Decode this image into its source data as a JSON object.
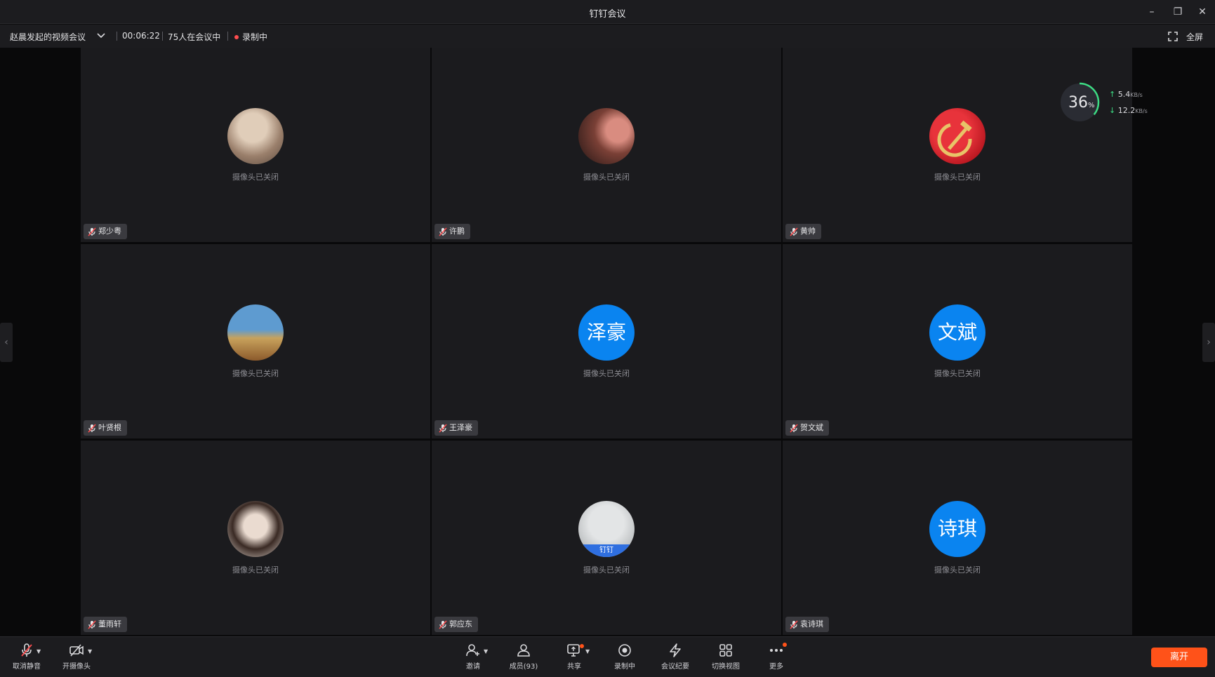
{
  "window": {
    "title": "钉钉会议",
    "minimize": "–",
    "maximize": "❐",
    "close": "✕"
  },
  "infobar": {
    "meeting_name": "赵晨发起的视频会议",
    "elapsed": "00:06:22",
    "attendees": "75人在会议中",
    "recording": "录制中",
    "fullscreen": "全屏"
  },
  "network": {
    "percent": "36",
    "percent_unit": "%",
    "up_rate": "5.4",
    "down_rate": "12.2",
    "rate_unit": "KB/s",
    "level": 0.36
  },
  "participants": [
    {
      "name": "郑少粤",
      "status": "摄像头已关闭",
      "avatar": "photo",
      "avatar_color": "#b59a86"
    },
    {
      "name": "许鹏",
      "status": "摄像头已关闭",
      "avatar": "photo",
      "avatar_color": "#7a4036"
    },
    {
      "name": "黄帅",
      "status": "摄像头已关闭",
      "avatar": "photo",
      "avatar_color": "#d6202b"
    },
    {
      "name": "叶贤根",
      "status": "摄像头已关闭",
      "avatar": "photo",
      "avatar_color": "#5e8cb4"
    },
    {
      "name": "王泽豪",
      "status": "摄像头已关闭",
      "avatar": "text",
      "avatar_text": "泽豪"
    },
    {
      "name": "贺文斌",
      "status": "摄像头已关闭",
      "avatar": "text",
      "avatar_text": "文斌"
    },
    {
      "name": "董雨轩",
      "status": "摄像头已关闭",
      "avatar": "photo",
      "avatar_color": "#cdbfb5"
    },
    {
      "name": "郭应东",
      "status": "摄像头已关闭",
      "avatar": "photo",
      "avatar_color": "#c6c8c9",
      "avatar_badge": "钉钉"
    },
    {
      "name": "袁诗琪",
      "status": "摄像头已关闭",
      "avatar": "text",
      "avatar_text": "诗琪"
    }
  ],
  "toolbar": {
    "unmute": "取消静音",
    "camera": "开摄像头",
    "invite": "邀请",
    "members": "成员(93)",
    "share": "共享",
    "recording": "录制中",
    "minutes": "会议纪要",
    "switch_view": "切换视图",
    "more": "更多",
    "leave": "离开"
  },
  "colors": {
    "accent_blue": "#0a84f0",
    "leave_orange": "#ff5219",
    "recording_red": "#ff4d4f"
  }
}
